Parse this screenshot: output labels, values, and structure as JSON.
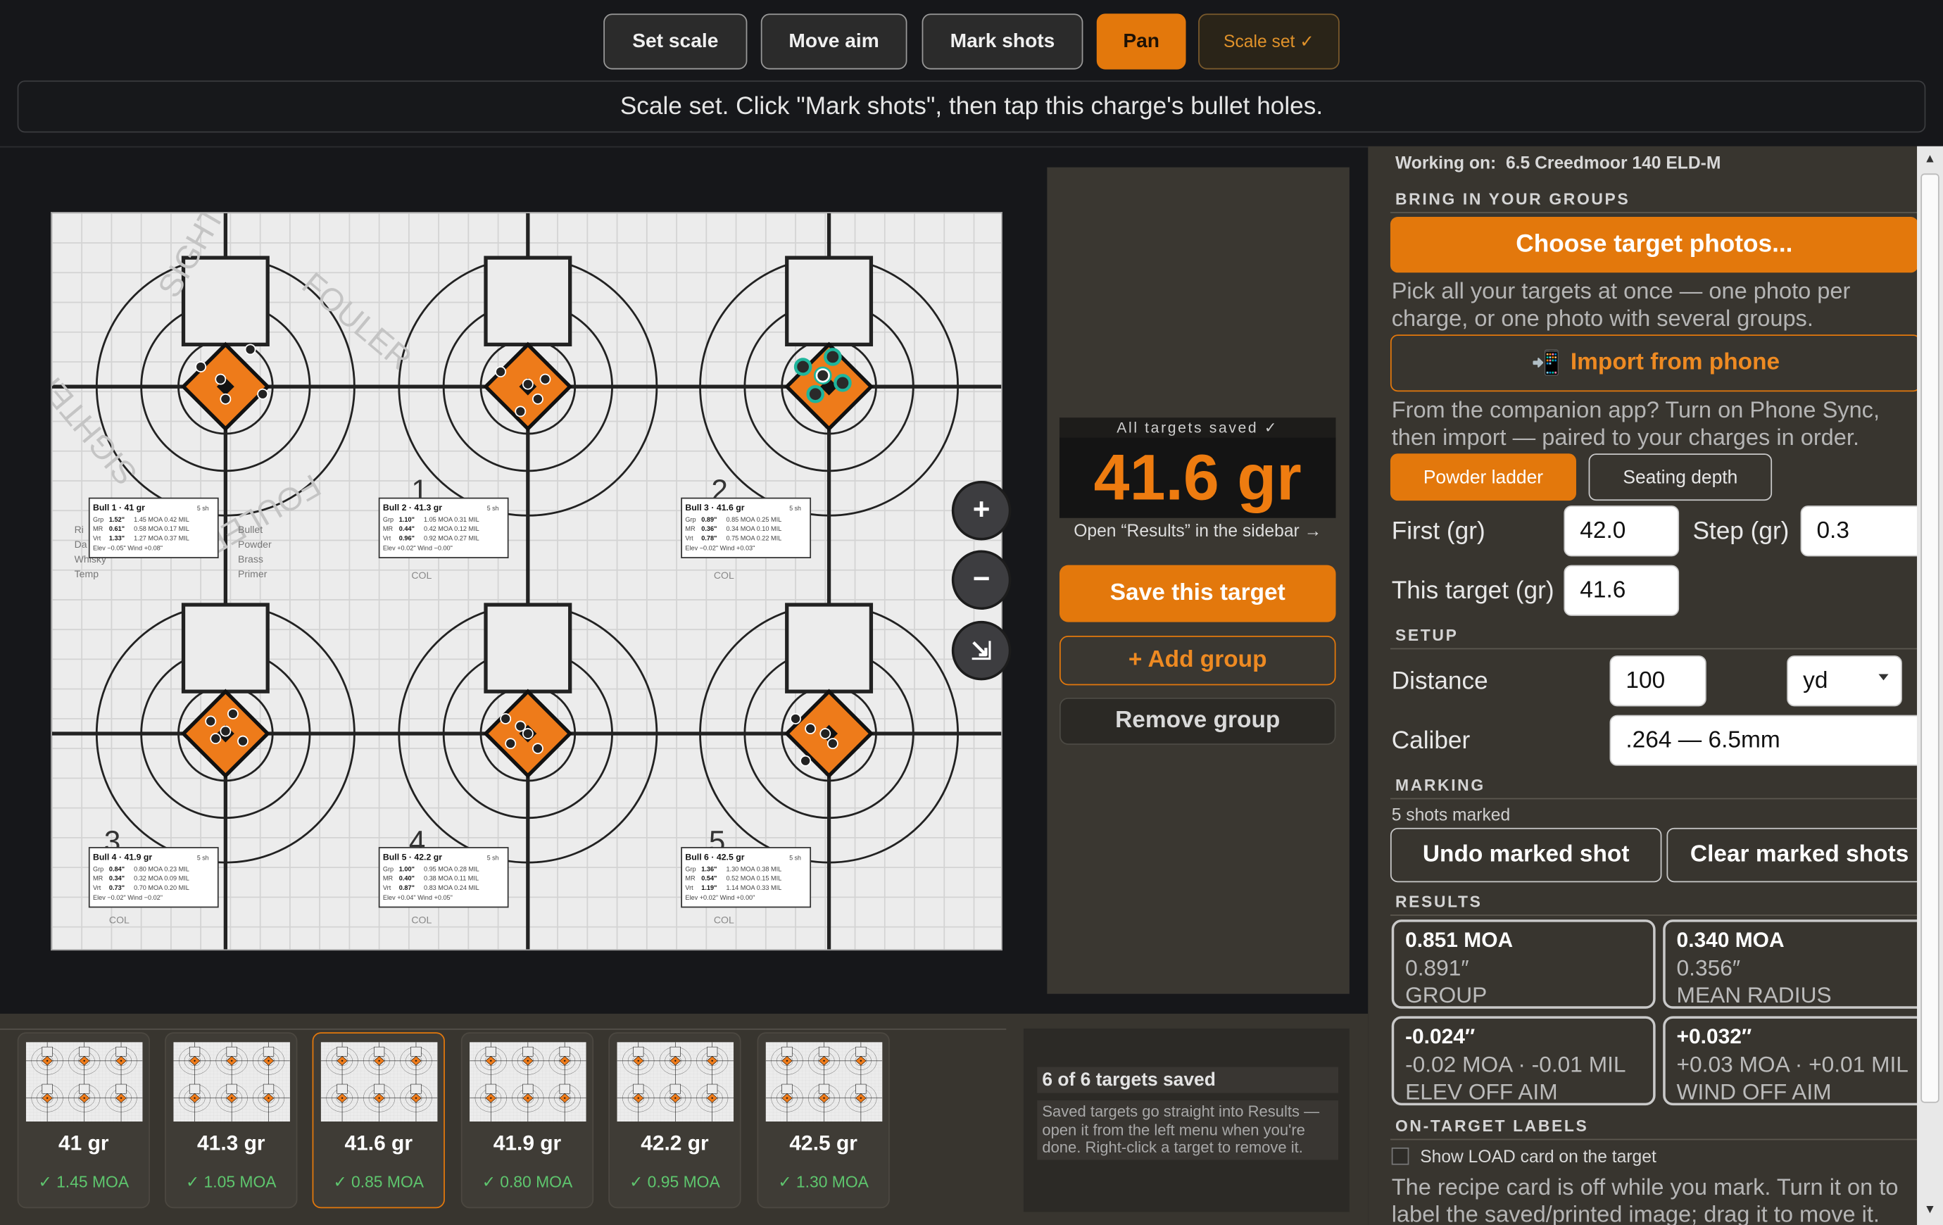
{
  "toolbar": {
    "buttons": [
      "Set scale",
      "Move aim",
      "Mark shots",
      "Pan"
    ],
    "scale_status": "Scale set ✓"
  },
  "status_message": "Scale set. Click \"Mark shots\", then tap this charge's bullet holes.",
  "target": {
    "bulls": [
      {
        "title": "Bull 1 · 41 gr",
        "shots": "5 sh",
        "grp": "1.52\"",
        "grp_detail": "1.45 MOA  0.42 MIL",
        "mr": "0.61\"",
        "mr_detail": "0.58 MOA  0.17 MIL",
        "vrt": "1.33\"",
        "vrt_detail": "1.27 MOA  0.37 MIL",
        "elev": "Elev −0.05\"   Wind +0.08\""
      },
      {
        "title": "Bull 2 · 41.3 gr",
        "shots": "5 sh",
        "grp": "1.10\"",
        "grp_detail": "1.05 MOA  0.31 MIL",
        "mr": "0.44\"",
        "mr_detail": "0.42 MOA  0.12 MIL",
        "vrt": "0.96\"",
        "vrt_detail": "0.92 MOA  0.27 MIL",
        "elev": "Elev +0.02\"   Wind −0.00\""
      },
      {
        "title": "Bull 3 · 41.6 gr",
        "shots": "5 sh",
        "grp": "0.89\"",
        "grp_detail": "0.85 MOA  0.25 MIL",
        "mr": "0.36\"",
        "mr_detail": "0.34 MOA  0.10 MIL",
        "vrt": "0.78\"",
        "vrt_detail": "0.75 MOA  0.22 MIL",
        "elev": "Elev −0.02\"   Wind +0.03\""
      },
      {
        "title": "Bull 4 · 41.9 gr",
        "shots": "5 sh",
        "grp": "0.84\"",
        "grp_detail": "0.80 MOA  0.23 MIL",
        "mr": "0.34\"",
        "mr_detail": "0.32 MOA  0.09 MIL",
        "vrt": "0.73\"",
        "vrt_detail": "0.70 MOA  0.20 MIL",
        "elev": "Elev −0.02\"   Wind −0.02\""
      },
      {
        "title": "Bull 5 · 42.2 gr",
        "shots": "5 sh",
        "grp": "1.00\"",
        "grp_detail": "0.95 MOA  0.28 MIL",
        "mr": "0.40\"",
        "mr_detail": "0.38 MOA  0.11 MIL",
        "vrt": "0.87\"",
        "vrt_detail": "0.83 MOA  0.24 MIL",
        "elev": "Elev +0.04\"   Wind +0.05\""
      },
      {
        "title": "Bull 6 · 42.5 gr",
        "shots": "5 sh",
        "grp": "1.36\"",
        "grp_detail": "1.30 MOA  0.38 MIL",
        "mr": "0.54\"",
        "mr_detail": "0.52 MOA  0.15 MIL",
        "vrt": "1.19\"",
        "vrt_detail": "1.14 MOA  0.33 MIL",
        "elev": "Elev +0.02\"   Wind +0.00\""
      }
    ],
    "row_labels": [
      "Grp",
      "MR",
      "Vrt"
    ],
    "printed_numbers": [
      "1",
      "2",
      "3",
      "4",
      "5"
    ],
    "printed_target_text": [
      "SIGHTER",
      "FOULER",
      "SIGHTER",
      "FOULER"
    ],
    "printed_form_fields": [
      "Bullet",
      "Powder",
      "Brass",
      "Primer"
    ],
    "printed_form_fields_left": [
      "Ri",
      "Da",
      "Whisky",
      "Temp"
    ],
    "col_label": "COL"
  },
  "zoom": {
    "in": "+",
    "out": "−",
    "fit": "⇲"
  },
  "center": {
    "saved_note": "All targets saved ✓",
    "charge": "41.6 gr",
    "open_results": "Open “Results” in the sidebar →",
    "save": "Save this target",
    "add": "+ Add group",
    "remove": "Remove group"
  },
  "thumbnails": [
    {
      "charge": "41 gr",
      "moa": "✓ 1.45 MOA"
    },
    {
      "charge": "41.3 gr",
      "moa": "✓ 1.05 MOA"
    },
    {
      "charge": "41.6 gr",
      "moa": "✓ 0.85 MOA"
    },
    {
      "charge": "41.9 gr",
      "moa": "✓ 0.80 MOA"
    },
    {
      "charge": "42.2 gr",
      "moa": "✓ 0.95 MOA"
    },
    {
      "charge": "42.5 gr",
      "moa": "✓ 1.30 MOA"
    }
  ],
  "saved_box": {
    "heading": "6 of 6 targets saved",
    "body": "Saved targets go straight into Results — open it from the left menu when you're done. Right-click a target to remove it."
  },
  "sidebar": {
    "working_on_label": "Working on:",
    "working_on_value": "6.5 Creedmoor 140 ELD-M",
    "bring_heading": "BRING IN YOUR GROUPS",
    "choose_photos": "Choose target photos...",
    "choose_help": "Pick all your targets at once — one photo per charge, or one photo with several groups.",
    "import_icon": "📲",
    "import_phone": "Import from phone",
    "import_help": "From the companion app? Turn on Phone Sync, then import — paired to your charges in order.",
    "mode_powder": "Powder ladder",
    "mode_seating": "Seating depth",
    "first_label": "First (gr)",
    "first_value": "42.0",
    "step_label": "Step (gr)",
    "step_value": "0.3",
    "this_label": "This target (gr)",
    "this_value": "41.6",
    "setup_heading": "SETUP",
    "distance_label": "Distance",
    "distance_value": "100",
    "distance_unit": "yd",
    "caliber_label": "Caliber",
    "caliber_value": ".264 — 6.5mm",
    "marking_heading": "MARKING",
    "shots_marked": "5 shots marked",
    "undo": "Undo marked shot",
    "clear": "Clear marked shots",
    "results_heading": "RESULTS",
    "results": [
      {
        "l1": "0.851 MOA",
        "l2": "0.891″",
        "l3": "GROUP"
      },
      {
        "l1": "0.340 MOA",
        "l2": "0.356″",
        "l3": "MEAN RADIUS"
      },
      {
        "l1": "-0.024″",
        "l2": "-0.02 MOA · -0.01 MIL",
        "l3": "ELEV OFF AIM"
      },
      {
        "l1": "+0.032″",
        "l2": "+0.03 MOA · +0.01 MIL",
        "l3": "WIND OFF AIM"
      }
    ],
    "labels_heading": "ON-TARGET LABELS",
    "show_load_card": "Show LOAD card on the target",
    "labels_help": "The recipe card is off while you mark. Turn it on to label the saved/printed image; drag it to move it."
  },
  "colors": {
    "accent": "#e3780c",
    "target_orange": "#ee7b1a",
    "success": "#5ec66e",
    "marked_shot": "#1fb59c"
  }
}
